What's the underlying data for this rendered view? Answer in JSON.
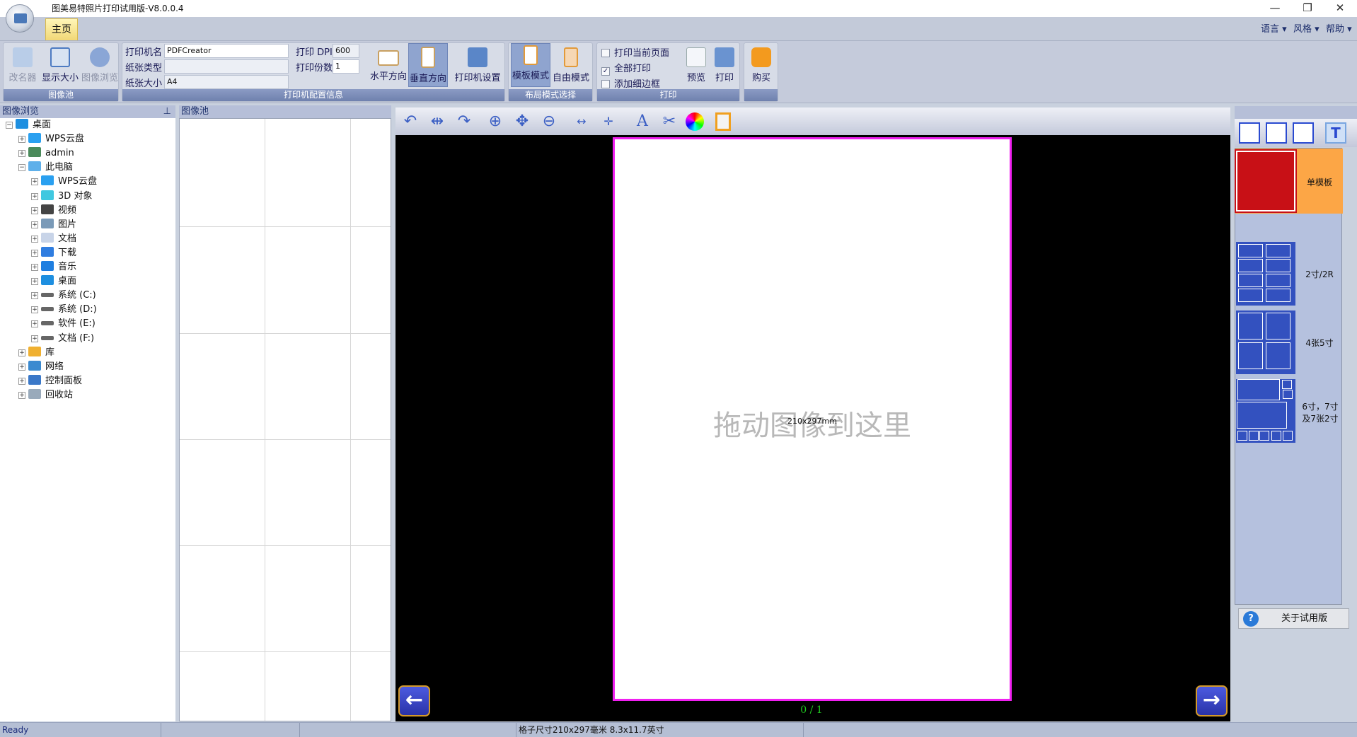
{
  "window": {
    "title": "图美易特照片打印试用版-V8.0.0.4",
    "minimize": "—",
    "restore": "❐",
    "close": "✕"
  },
  "tabs": [
    {
      "label": "主页"
    }
  ],
  "top_menu": [
    {
      "label": "语言"
    },
    {
      "label": "风格"
    },
    {
      "label": "帮助"
    }
  ],
  "ribbon": {
    "image_pool": {
      "label": "图像池",
      "rename": "改名器",
      "display_size": "显示大小",
      "image_browse": "图像浏览"
    },
    "printer_config": {
      "label": "打印机配置信息",
      "printer_name_label": "打印机名",
      "printer_name": "PDFCreator",
      "paper_type_label": "纸张类型",
      "paper_type": "",
      "paper_size_label": "纸张大小",
      "paper_size": "A4",
      "dpi_label": "打印 DPI:",
      "dpi": "600",
      "copies_label": "打印份数",
      "copies": "1",
      "landscape": "水平方向",
      "portrait": "垂直方向",
      "printer_settings": "打印机设置"
    },
    "layout_mode": {
      "label": "布局模式选择",
      "template": "模板模式",
      "free": "自由模式"
    },
    "print": {
      "label": "打印",
      "print_current": "打印当前页面",
      "print_current_checked": false,
      "print_all": "全部打印",
      "print_all_checked": true,
      "add_border": "添加细边框",
      "add_border_checked": false,
      "preview": "预览",
      "print": "打印"
    },
    "buy": {
      "label": "购买"
    }
  },
  "browser": {
    "title": "图像浏览",
    "pin": "⊥",
    "tree": [
      {
        "label": "桌面",
        "level": 0,
        "expanded": true,
        "icon": "desktop"
      },
      {
        "label": "WPS云盘",
        "level": 1,
        "icon": "cloud"
      },
      {
        "label": "admin",
        "level": 1,
        "icon": "user"
      },
      {
        "label": "此电脑",
        "level": 1,
        "expanded": true,
        "icon": "computer"
      },
      {
        "label": "WPS云盘",
        "level": 2,
        "icon": "cloud"
      },
      {
        "label": "3D 对象",
        "level": 2,
        "icon": "cube"
      },
      {
        "label": "视频",
        "level": 2,
        "icon": "video"
      },
      {
        "label": "图片",
        "level": 2,
        "icon": "picture"
      },
      {
        "label": "文档",
        "level": 2,
        "icon": "document"
      },
      {
        "label": "下载",
        "level": 2,
        "icon": "download"
      },
      {
        "label": "音乐",
        "level": 2,
        "icon": "music"
      },
      {
        "label": "桌面",
        "level": 2,
        "icon": "desktop"
      },
      {
        "label": "系统 (C:)",
        "level": 2,
        "icon": "drive"
      },
      {
        "label": "系统 (D:)",
        "level": 2,
        "icon": "drive"
      },
      {
        "label": "软件 (E:)",
        "level": 2,
        "icon": "drive"
      },
      {
        "label": "文档 (F:)",
        "level": 2,
        "icon": "drive"
      },
      {
        "label": "库",
        "level": 1,
        "icon": "library"
      },
      {
        "label": "网络",
        "level": 1,
        "icon": "network"
      },
      {
        "label": "控制面板",
        "level": 1,
        "icon": "control-panel"
      },
      {
        "label": "回收站",
        "level": 1,
        "icon": "recycle-bin"
      }
    ]
  },
  "pool": {
    "title": "图像池"
  },
  "canvas": {
    "drop_hint": "拖动图像到这里",
    "paper_size": "210x297mm",
    "page_indicator": "0 / 1"
  },
  "templates": [
    {
      "label": "单模板",
      "selected": true
    },
    {
      "label": "2寸/2R"
    },
    {
      "label": "4张5寸"
    },
    {
      "label": "6寸，7寸及7张2寸"
    }
  ],
  "about_label": "关于试用版",
  "status": {
    "ready": "Ready",
    "grid_size": "格子尺寸210x297毫米  8.3x11.7英寸"
  },
  "colors": {
    "accent": "#3351bf",
    "selected_template": "#fca646",
    "page_border": "#f020f0"
  }
}
